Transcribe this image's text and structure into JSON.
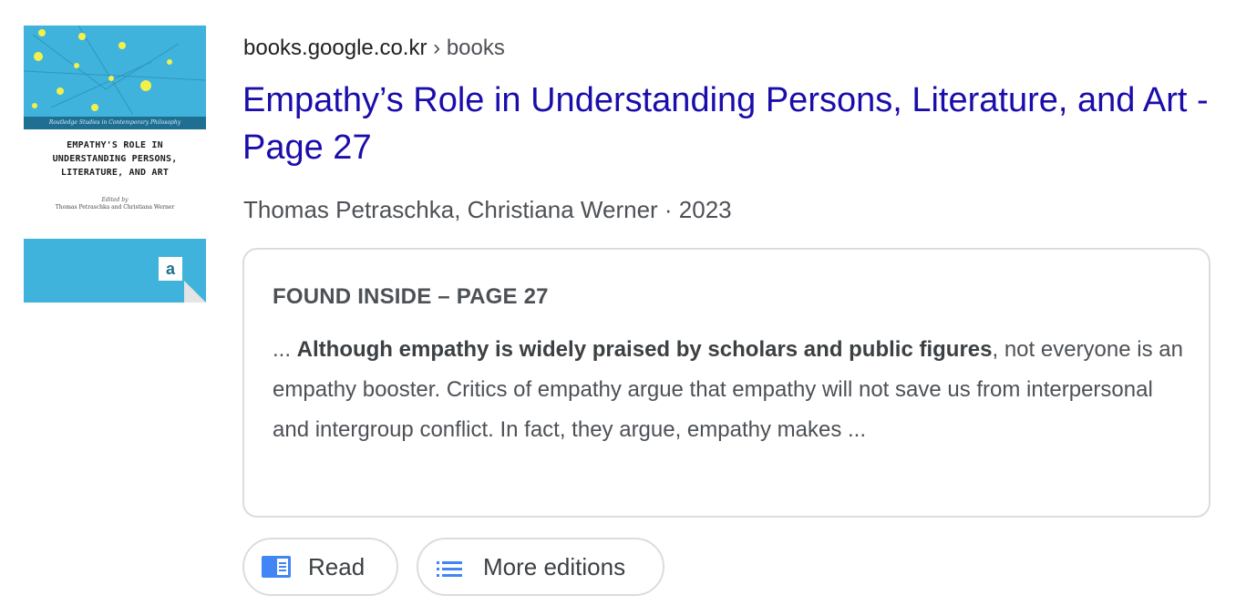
{
  "result": {
    "site": "books.google.co.kr",
    "breadcrumb_sep": "›",
    "breadcrumb": "books",
    "title": "Empathy’s Role in Understanding Persons, Literature, and Art - Page 27",
    "meta": "Thomas Petraschka, Christiana Werner · 2023"
  },
  "cover": {
    "series": "Routledge Studies in Contemporary Philosophy",
    "title_lines": [
      "EMPATHY'S ROLE IN",
      "UNDERSTANDING PERSONS,",
      "LITERATURE, AND ART"
    ],
    "editors_label": "Edited by",
    "editors": "Thomas Petraschka and Christiana Werner",
    "logo": "a",
    "colors": {
      "background": "#3fb3dc",
      "dots": "#f4f04a",
      "lines": "#2a8fb8"
    }
  },
  "found_inside": {
    "heading": "FOUND INSIDE – PAGE 27",
    "lead": "... ",
    "bold": "Although empathy is widely praised by scholars and public figures",
    "rest": ", not everyone is an empathy booster. Critics of empathy argue that empathy will not save us from interpersonal and intergroup conflict. In fact, they argue, empathy makes ..."
  },
  "buttons": {
    "read": {
      "label": "Read",
      "icon": "book-read-icon"
    },
    "editions": {
      "label": "More editions",
      "icon": "list-icon"
    }
  },
  "colors": {
    "title_link": "#1a0dab",
    "text": "#4d5156",
    "border": "#dadce0",
    "icon_blue": "#4285f4"
  }
}
